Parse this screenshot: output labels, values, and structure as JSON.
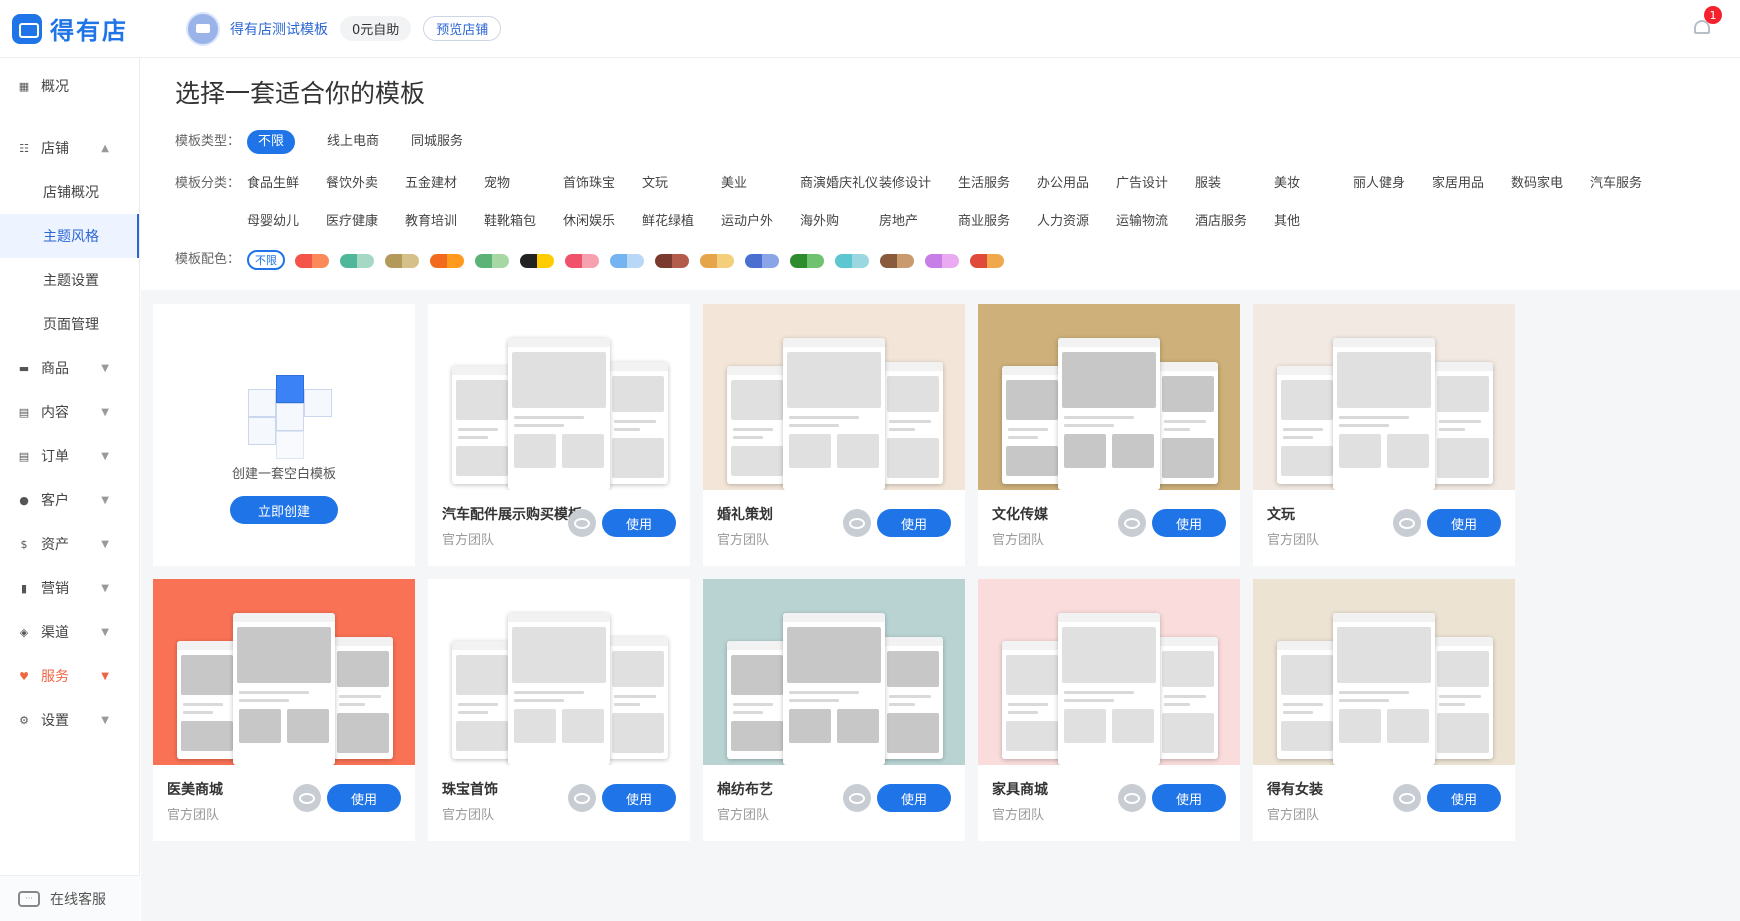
{
  "header": {
    "logo_text": "得有店",
    "shop_name": "得有店测试模板",
    "plan_label": "0元自助",
    "preview_label": "预览店铺",
    "notification_count": "1"
  },
  "sidebar": {
    "overview": "概况",
    "store": "店铺",
    "store_sub": [
      "店铺概况",
      "主题风格",
      "主题设置",
      "页面管理"
    ],
    "items": [
      "商品",
      "内容",
      "订单",
      "客户",
      "资产",
      "营销",
      "渠道",
      "服务",
      "设置"
    ],
    "service_label": "在线客服"
  },
  "filters": {
    "title": "选择一套适合你的模板",
    "type_label": "模板类型：",
    "types": [
      "不限",
      "线上电商",
      "同城服务"
    ],
    "category_label": "模板分类：",
    "categories": [
      "食品生鲜",
      "餐饮外卖",
      "五金建材",
      "宠物",
      "首饰珠宝",
      "文玩",
      "美业",
      "商演婚庆礼仪",
      "装修设计",
      "生活服务",
      "办公用品",
      "广告设计",
      "服装",
      "美妆",
      "丽人健身",
      "家居用品",
      "数码家电",
      "汽车服务",
      "母婴幼儿",
      "医疗健康",
      "教育培训",
      "鞋靴箱包",
      "休闲娱乐",
      "鲜花绿植",
      "运动户外",
      "海外购",
      "房地产",
      "商业服务",
      "人力资源",
      "运输物流",
      "酒店服务",
      "其他"
    ],
    "color_label": "模板配色：",
    "color_all": "不限",
    "colors": [
      [
        "#f5544a",
        "#fb8a5b"
      ],
      [
        "#4fb89b",
        "#a6d9c5"
      ],
      [
        "#b39a5a",
        "#d6c08a"
      ],
      [
        "#f26a1e",
        "#ff9a1f"
      ],
      [
        "#5bb377",
        "#a7d8a4"
      ],
      [
        "#222222",
        "#ffcc00"
      ],
      [
        "#f0516b",
        "#f7a0b0"
      ],
      [
        "#74b4f0",
        "#b9d8f7"
      ],
      [
        "#7a3b2e",
        "#b35c4c"
      ],
      [
        "#e7a54a",
        "#f4cf7b"
      ],
      [
        "#4a6fd0",
        "#8aa4e8"
      ],
      [
        "#2e8c2e",
        "#6fc26f"
      ],
      [
        "#5cc6d1",
        "#9ad7e0"
      ],
      [
        "#8a5a3c",
        "#c89a6e"
      ],
      [
        "#c77ee6",
        "#eaaaf2"
      ],
      [
        "#e04a3a",
        "#f0a94a"
      ]
    ]
  },
  "blank_card": {
    "text": "创建一套空白模板",
    "button": "立即创建"
  },
  "templates": [
    {
      "name": "汽车配件展示购买模板",
      "author": "官方团队",
      "use": "使用"
    },
    {
      "name": "婚礼策划",
      "author": "官方团队",
      "use": "使用"
    },
    {
      "name": "文化传媒",
      "author": "官方团队",
      "use": "使用"
    },
    {
      "name": "文玩",
      "author": "官方团队",
      "use": "使用"
    },
    {
      "name": "医美商城",
      "author": "官方团队",
      "use": "使用"
    },
    {
      "name": "珠宝首饰",
      "author": "官方团队",
      "use": "使用"
    },
    {
      "name": "棉纺布艺",
      "author": "官方团队",
      "use": "使用"
    },
    {
      "name": "家具商城",
      "author": "官方团队",
      "use": "使用"
    },
    {
      "name": "得有女装",
      "author": "官方团队",
      "use": "使用"
    }
  ],
  "thumb_colors": [
    "#ffffff",
    "#f3e6d8",
    "#cdb07a",
    "#f2e9e2",
    "#fa7255",
    "#ffffff",
    "#b9d3d3",
    "#fadcdc",
    "#ece3d3"
  ],
  "accent": "#1f74e8"
}
